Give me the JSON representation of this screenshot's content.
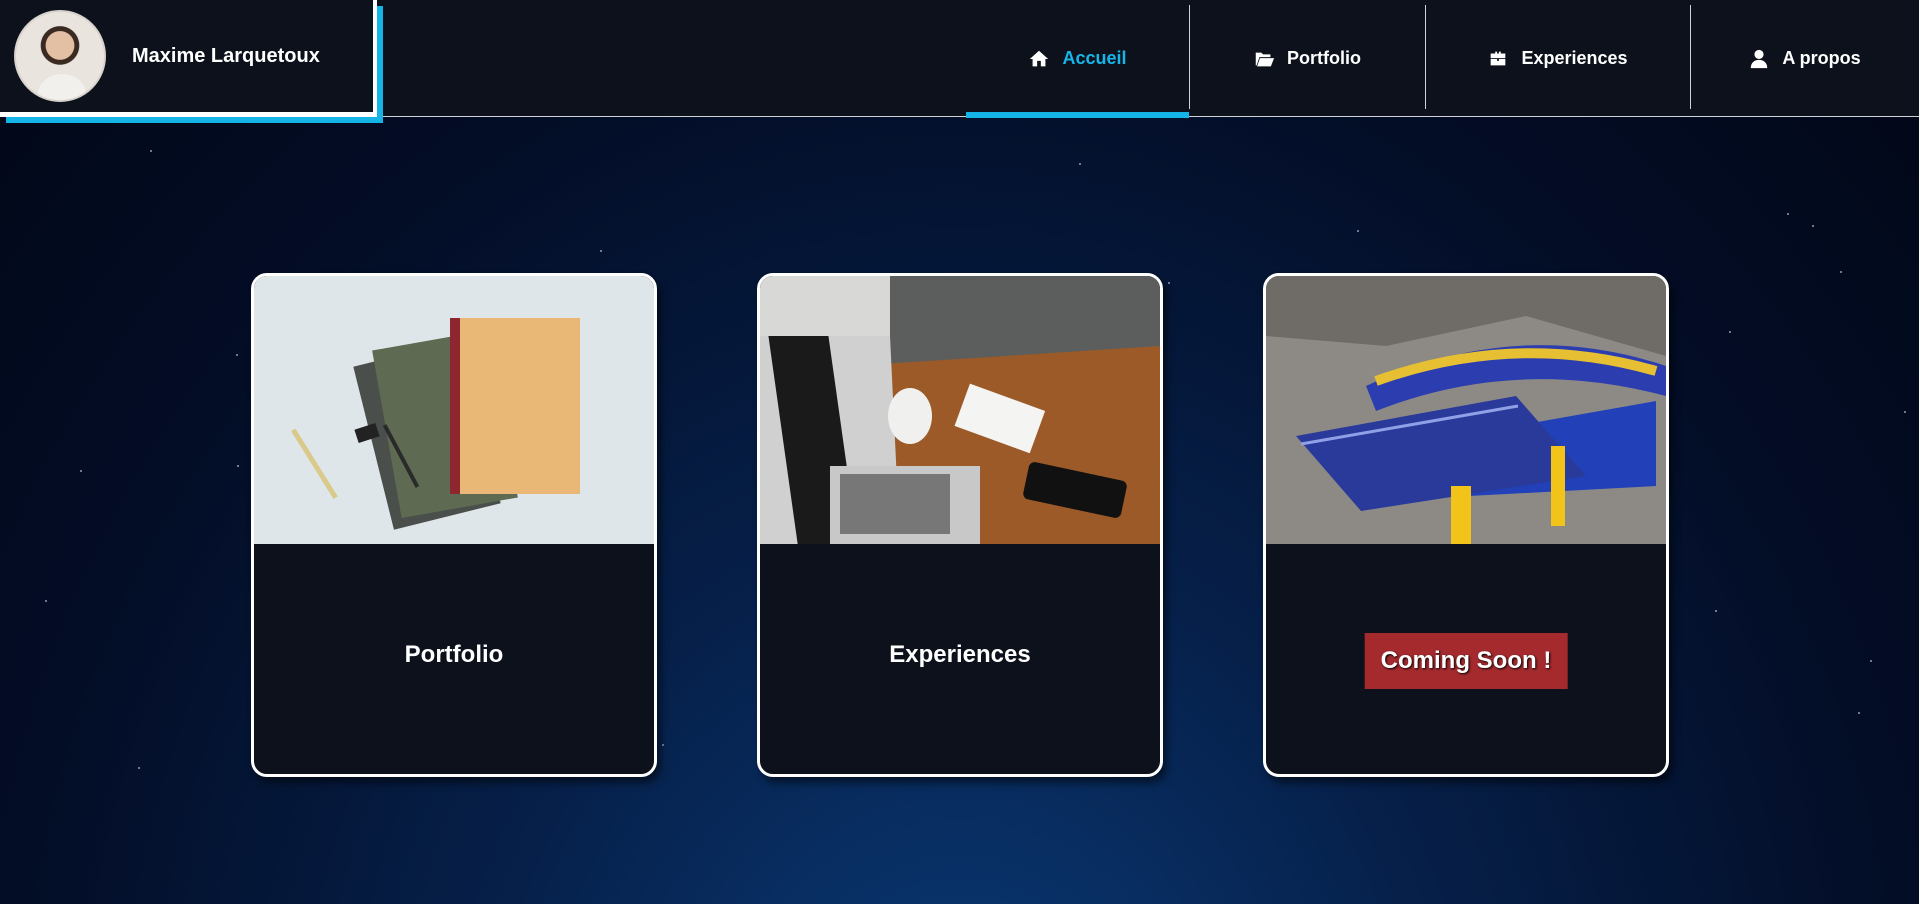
{
  "header": {
    "name": "Maxime Larquetoux",
    "avatar_icon": "portrait-photo",
    "accent_color": "#14b4e6"
  },
  "nav": {
    "items": [
      {
        "label": "Accueil",
        "icon": "home-icon",
        "active": true
      },
      {
        "label": "Portfolio",
        "icon": "folder-open-icon",
        "active": false
      },
      {
        "label": "Experiences",
        "icon": "briefcase-icon",
        "active": false
      },
      {
        "label": "A propos",
        "icon": "user-icon",
        "active": false
      }
    ]
  },
  "cards": [
    {
      "title": "Portfolio",
      "image": "notebooks-and-pen-photo"
    },
    {
      "title": "Experiences",
      "image": "laptop-desk-coffee-photo"
    },
    {
      "badge": "Coming Soon !",
      "image": "diploma-graduation-cap-photo",
      "badge_color": "#a42a2e"
    }
  ]
}
